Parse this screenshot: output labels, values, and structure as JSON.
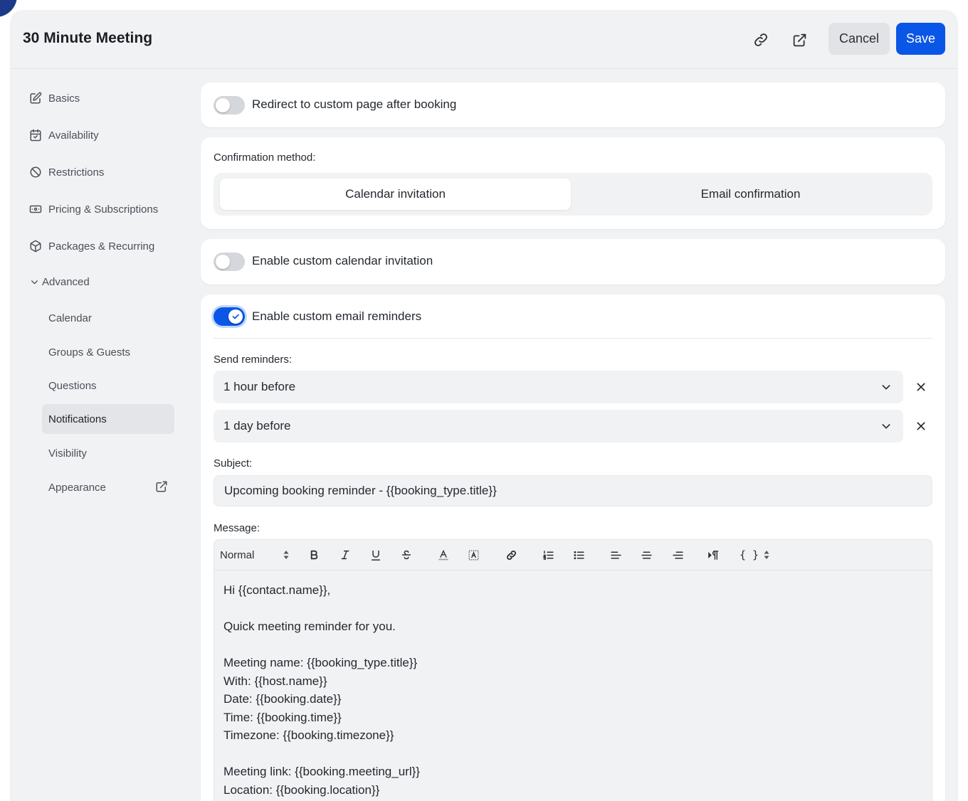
{
  "header": {
    "title": "30 Minute Meeting",
    "link_icon": "link-icon",
    "external_icon": "external-link-icon",
    "cancel_label": "Cancel",
    "save_label": "Save"
  },
  "sidebar": {
    "items": [
      {
        "label": "Basics",
        "icon": "edit-icon"
      },
      {
        "label": "Availability",
        "icon": "calendar-check-icon"
      },
      {
        "label": "Restrictions",
        "icon": "ban-icon"
      },
      {
        "label": "Pricing & Subscriptions",
        "icon": "money-icon"
      },
      {
        "label": "Packages & Recurring",
        "icon": "package-icon"
      }
    ],
    "advanced": {
      "label": "Advanced",
      "items": [
        "Calendar",
        "Groups & Guests",
        "Questions",
        "Notifications",
        "Visibility",
        "Appearance"
      ],
      "active": "Notifications"
    }
  },
  "redirect": {
    "label": "Redirect to custom page after booking",
    "enabled": false
  },
  "confirmation": {
    "label": "Confirmation method:",
    "options": [
      "Calendar invitation",
      "Email confirmation"
    ],
    "selected": "Calendar invitation"
  },
  "custom_calendar": {
    "label": "Enable custom calendar invitation",
    "enabled": false
  },
  "email_reminders": {
    "label": "Enable custom email reminders",
    "enabled": true,
    "send_label": "Send reminders:",
    "reminders": [
      "1 hour before",
      "1 day before"
    ],
    "subject_label": "Subject:",
    "subject_value": "Upcoming booking reminder - {{booking_type.title}}",
    "message_label": "Message:",
    "format_value": "Normal",
    "toolbar": {
      "vars": "{ }"
    },
    "message_text": "Hi {{contact.name}},\n\nQuick meeting reminder for you.\n\nMeeting name: {{booking_type.title}}\nWith: {{host.name}}\nDate: {{booking.date}}\nTime: {{booking.time}}\nTimezone: {{booking.timezone}}\n\nMeeting link: {{booking.meeting_url}}\nLocation: {{booking.location}}"
  },
  "colors": {
    "accent": "#0a56e6",
    "background": "#f1f2f4",
    "card": "#ffffff"
  }
}
